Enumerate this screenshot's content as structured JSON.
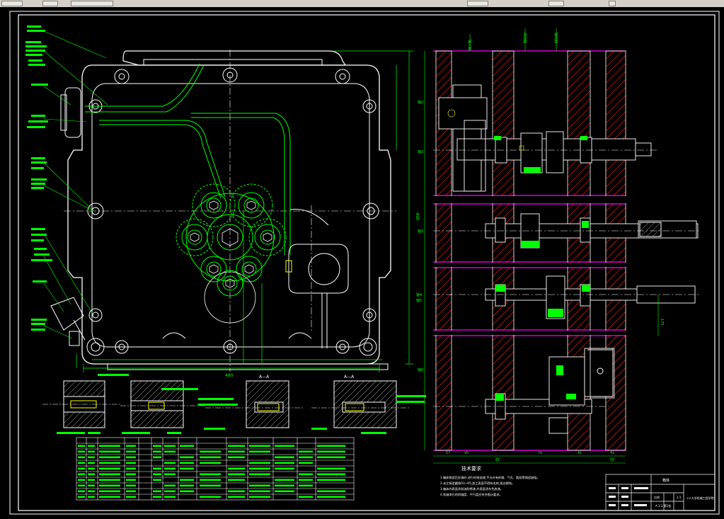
{
  "drawing": {
    "title_caption": "技术要求",
    "notes": [
      "1.箱体铸造后应清砂,进行时效处理,不允许有砂眼、气孔、裂纹等铸造缺陷。",
      "2.未注铸造圆角R3~R5,加工表面不得有毛刺,锐边倒钝。",
      "3.箱体内表面涂耐油防锈漆,外表面涂灰色底漆。",
      "4.各轴承孔的同轴度、平行度应符合图示要求。"
    ],
    "section_label": "A—A",
    "view_labels": {
      "left_detail": "放大 2:1",
      "right_detail": "放大 2:1",
      "mid_detail": "放大 2:1"
    },
    "dims": {
      "width_bottom": "480",
      "height_right": "490",
      "dim_57": "57",
      "dim_95": "95",
      "dim_81": "81",
      "dim_76": "76",
      "dim_41": "41",
      "dim_55": "55",
      "dim_41b": "41",
      "dim_175": "175"
    },
    "shaft_labels": [
      "输入轴",
      "中间轴",
      "输出轴"
    ],
    "row_labels": [
      "轴1",
      "轴2",
      "轴3",
      "轴4",
      "轴5",
      "轴6"
    ],
    "title_block": {
      "name": "箱体",
      "company": "××大学机械工程学院",
      "scale_label": "比例",
      "scale": "1:1",
      "sheet": "A 1:1 第1张"
    },
    "table_header": [
      "序号",
      "数量",
      "名称",
      "材料",
      "规格",
      "标准",
      "备注"
    ]
  },
  "colors": {
    "background": "#000000",
    "outline": "#ffffff",
    "green": "#00ff00",
    "red": "#ff2020",
    "magenta": "#ff00ff",
    "yellow": "#ffff00",
    "cyan": "#00ffff"
  }
}
